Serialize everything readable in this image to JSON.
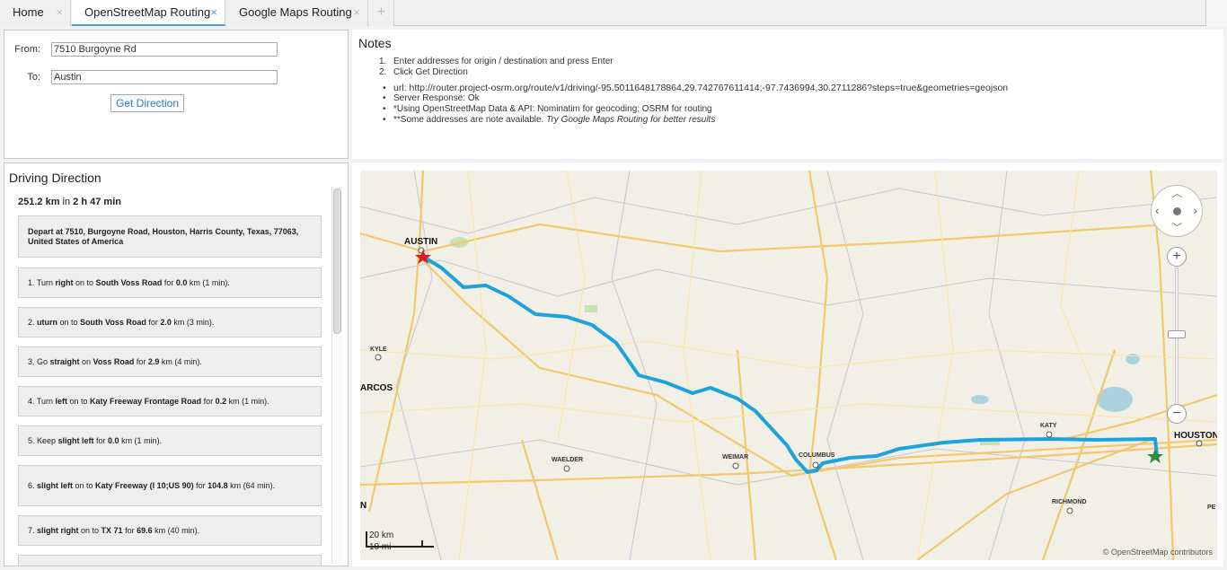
{
  "tabs": [
    {
      "label": "Home",
      "close": "×"
    },
    {
      "label": "OpenStreetMap Routing",
      "close": "×"
    },
    {
      "label": "Google Maps Routing",
      "close": "×"
    },
    {
      "label": "+"
    }
  ],
  "form": {
    "from_label": "From:",
    "from_value": "7510 Burgoyne Rd",
    "to_label": "To:",
    "to_value": "Austin",
    "button_label": "Get Direction"
  },
  "notes": {
    "title": "Notes",
    "ordered": [
      {
        "num": "1.",
        "text": "Enter addresses for origin / destination and press Enter"
      },
      {
        "num": "2.",
        "text": "Click Get Direction"
      }
    ],
    "url_text": "url: http://router.project-osrm.org/route/v1/driving/-95.5011648178864,29.742767611414;-97.7436994,30.2711286?steps=true&geometries=geojson",
    "server_response": "Server Response: Ok",
    "data_api": "*Using OpenStreetMap Data & API: Nominatim for geocoding; OSRM for routing",
    "some_addresses": "**Some addresses are note available.",
    "some_addresses_hint": "Try Google Maps Routing for better results"
  },
  "directions": {
    "title": "Driving Direction",
    "distance": "251.2 km",
    "in_word": "in",
    "duration": "2 h 47 min",
    "steps": [
      {
        "pre": "Depart at 7510, Burgoyne Road, Houston, Harris County, Texas, 77063, United States of America",
        "bold_all": true
      },
      {
        "pre": "1. Turn ",
        "b1": "right",
        "mid": " on to ",
        "b2": "South Voss Road",
        "mid2": " for ",
        "b3": "0.0",
        "post": " km (1 min)."
      },
      {
        "pre": "2. ",
        "b1": "uturn",
        "mid": " on to ",
        "b2": "South Voss Road",
        "mid2": " for ",
        "b3": "2.0",
        "post": " km (3 min)."
      },
      {
        "pre": "3. Go ",
        "b1": "straight",
        "mid": " on ",
        "b2": "Voss Road",
        "mid2": " for ",
        "b3": "2.9",
        "post": " km (4 min)."
      },
      {
        "pre": "4. Turn ",
        "b1": "left",
        "mid": " on to ",
        "b2": "Katy Freeway Frontage Road",
        "mid2": " for ",
        "b3": "0.2",
        "post": " km (1 min)."
      },
      {
        "pre": "5. Keep ",
        "b1": "slight left",
        "mid": " for ",
        "b2": "",
        "mid2": "",
        "b3": "0.0",
        "post": " km (1 min)."
      },
      {
        "pre": "6. ",
        "b1": "slight left",
        "mid": " on to ",
        "b2": "Katy Freeway (I 10;US 90)",
        "mid2": " for ",
        "b3": "104.8",
        "post": " km (64 min)."
      },
      {
        "pre": "7. ",
        "b1": "slight right",
        "mid": " on to ",
        "b2": "TX 71",
        "mid2": " for ",
        "b3": "69.6",
        "post": " km (40 min)."
      }
    ]
  },
  "map": {
    "labels": {
      "austin": "AUSTIN",
      "kyle": "KYLE",
      "marcos": "ARCOS",
      "waelder": "WAELDER",
      "weimar": "WEIMAR",
      "columbus": "COLUMBUS",
      "katy": "KATY",
      "houston": "HOUSTON",
      "richmond": "RICHMOND",
      "pe": "PE",
      "n": "N"
    },
    "scale_km": "20 km",
    "scale_mi": "10 mi",
    "attribution": "© OpenStreetMap contributors",
    "route_color": "#1aa3dc",
    "start_color": "#2e8b3e",
    "end_color": "#d42020"
  }
}
